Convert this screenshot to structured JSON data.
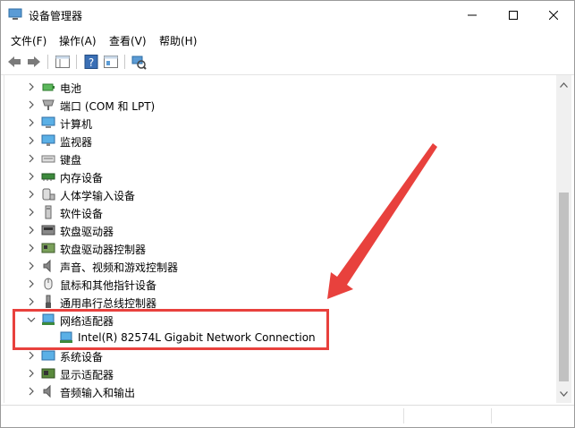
{
  "window": {
    "title": "设备管理器"
  },
  "menu": {
    "file": "文件(F)",
    "action": "操作(A)",
    "view": "查看(V)",
    "help": "帮助(H)"
  },
  "tree": {
    "battery": "电池",
    "ports": "端口 (COM 和 LPT)",
    "computer": "计算机",
    "monitors": "监视器",
    "keyboards": "键盘",
    "memory": "内存设备",
    "hid": "人体学输入设备",
    "software_devices": "软件设备",
    "disk_drives": "软盘驱动器",
    "floppy_controllers": "软盘驱动器控制器",
    "sound": "声音、视频和游戏控制器",
    "mice": "鼠标和其他指针设备",
    "usb": "通用串行总线控制器",
    "network_adapters": "网络适配器",
    "network_adapter_child": "Intel(R) 82574L Gigabit Network Connection",
    "system_devices": "系统设备",
    "display_adapters": "显示适配器",
    "audio_io": "音频输入和输出"
  },
  "colors": {
    "highlight": "#e8413d",
    "arrow": "#e8413d"
  }
}
